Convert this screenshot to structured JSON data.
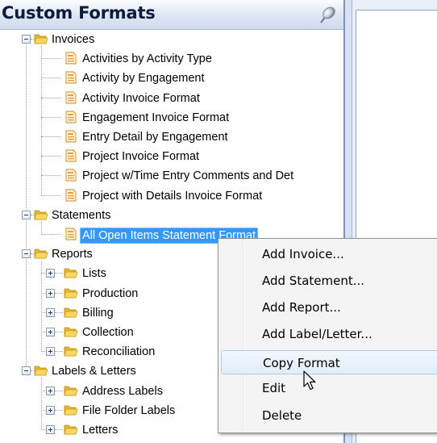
{
  "panel": {
    "title": "Custom Formats",
    "pin_icon": "pin-icon"
  },
  "tree": {
    "invoices": {
      "label": "Invoices",
      "items": [
        "Activities by Activity Type",
        "Activity by Engagement",
        "Activity Invoice Format",
        "Engagement Invoice Format",
        "Entry Detail by Engagement",
        "Project Invoice Format",
        "Project w/Time Entry Comments and Det",
        "Project with Details Invoice Format"
      ]
    },
    "statements": {
      "label": "Statements",
      "items": [
        "All Open Items Statement Format"
      ]
    },
    "reports": {
      "label": "Reports",
      "items": [
        "Lists",
        "Production",
        "Billing",
        "Collection",
        "Reconciliation"
      ]
    },
    "labels_letters": {
      "label": "Labels & Letters",
      "items": [
        "Address Labels",
        "File Folder Labels",
        "Letters"
      ]
    }
  },
  "context_menu": {
    "items": [
      "Add Invoice...",
      "Add Statement...",
      "Add Report...",
      "Add Label/Letter...",
      "Copy Format",
      "Edit",
      "Delete"
    ],
    "hovered_item": "Copy Format"
  },
  "colors": {
    "selection": "#3399ff",
    "header_text": "#0c1c3c",
    "folder": "#f2c744",
    "menu_hover": "#e3edfc"
  }
}
